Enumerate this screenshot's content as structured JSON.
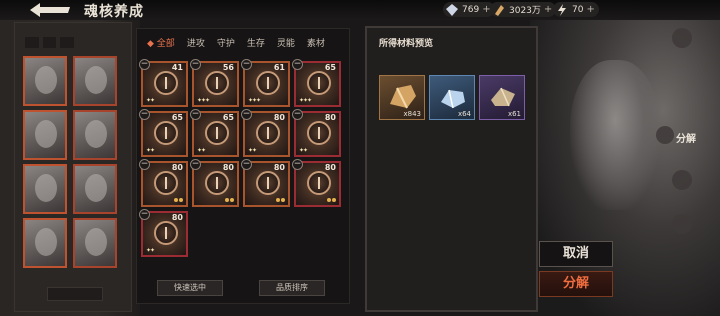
{
  "header": {
    "title": "魂核养成",
    "currencies": [
      {
        "icon": "crystal-icon",
        "value": "769"
      },
      {
        "icon": "coin-icon",
        "value": "3023万"
      },
      {
        "icon": "lightning-icon",
        "value": "70"
      }
    ]
  },
  "tabs": [
    {
      "label": "全部",
      "active": true
    },
    {
      "label": "进攻"
    },
    {
      "label": "守护"
    },
    {
      "label": "生存"
    },
    {
      "label": "灵能"
    },
    {
      "label": "素材"
    }
  ],
  "cores": [
    {
      "level": "41"
    },
    {
      "level": "56"
    },
    {
      "level": "61"
    },
    {
      "level": "65"
    },
    {
      "level": "65"
    },
    {
      "level": "65"
    },
    {
      "level": "80"
    },
    {
      "level": "80"
    },
    {
      "level": "80"
    },
    {
      "level": "80"
    },
    {
      "level": "80"
    },
    {
      "level": "80"
    },
    {
      "level": "80"
    }
  ],
  "inventory_buttons": {
    "quick_select": "快速选中",
    "sort_quality": "品质排序"
  },
  "materials_panel": {
    "title": "所得材料预览",
    "items": [
      {
        "icon": "gold-essence-icon",
        "count": "x843"
      },
      {
        "icon": "blue-essence-icon",
        "count": "x64"
      },
      {
        "icon": "purple-essence-icon",
        "count": "x61"
      }
    ]
  },
  "actions": {
    "cancel": "取消",
    "decompose": "分解"
  },
  "side_nav": {
    "decompose_label": "分解"
  },
  "colors": {
    "accent": "#e8724f",
    "card_border": "#a8542c",
    "card_border_alt": "#9c2c34"
  }
}
